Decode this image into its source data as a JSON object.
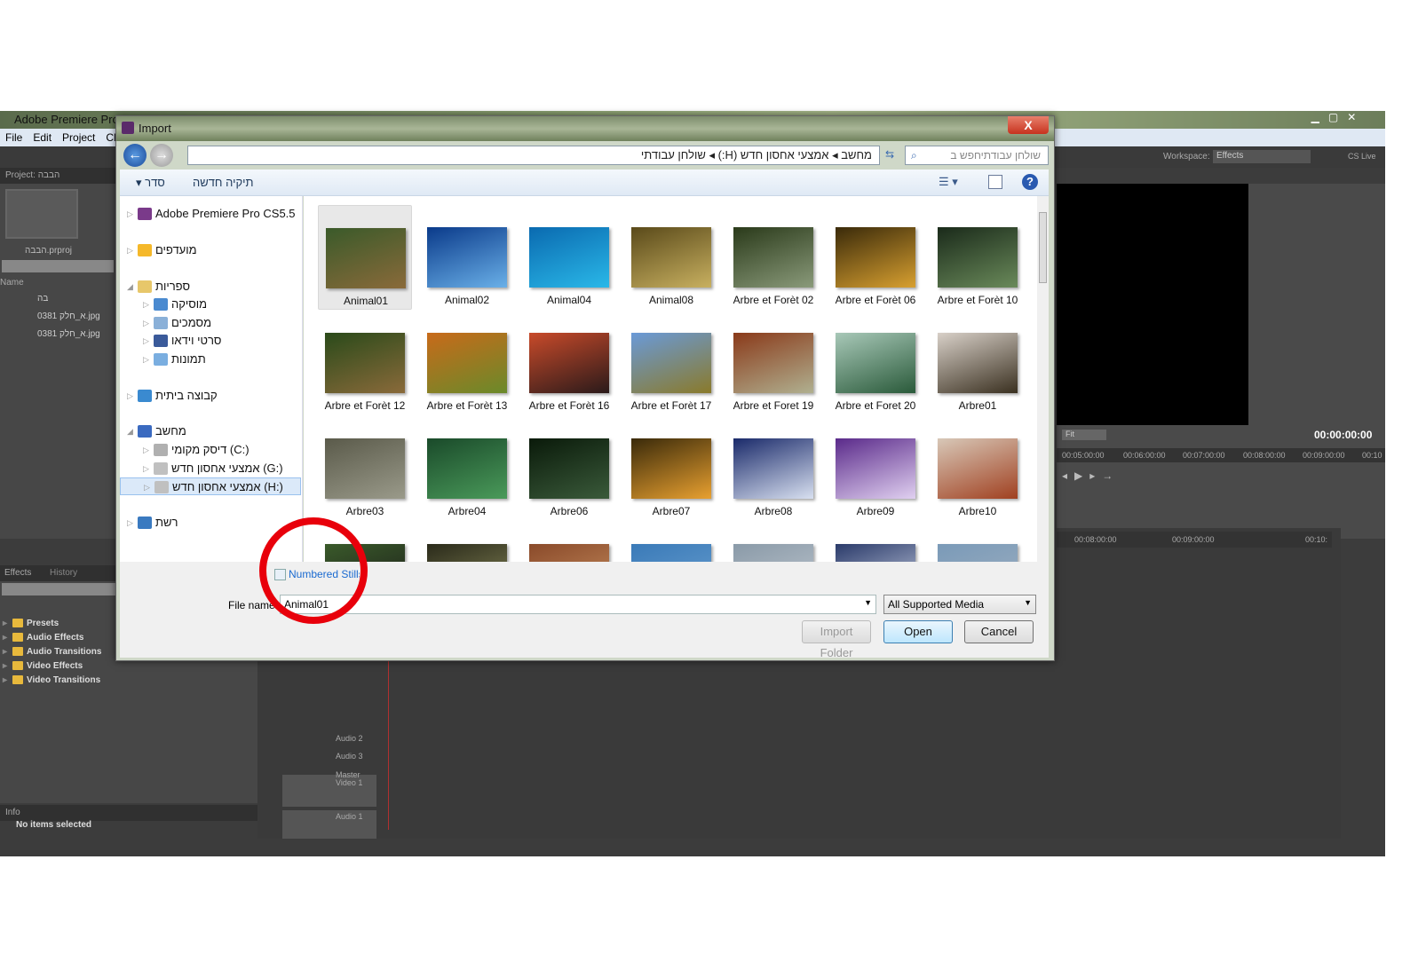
{
  "app": {
    "title": "Adobe Premiere Pro",
    "menu": [
      "File",
      "Edit",
      "Project",
      "Clip"
    ],
    "workspace_label": "Workspace:",
    "workspace_value": "Effects",
    "cslive": "CS Live",
    "project_tab": "Project: הבבה",
    "project_file": "הבבה.prproj",
    "name_col": "Name",
    "project_items": [
      "בה",
      "0381 א_חלק.jpg",
      "0381 א_חלק.jpg"
    ],
    "effects_tabs": [
      "Effects",
      "History"
    ],
    "effects_tree": [
      "Presets",
      "Audio Effects",
      "Audio Transitions",
      "Video Effects",
      "Video Transitions"
    ],
    "info_tab": "Info",
    "info_text": "No items selected",
    "monitor": {
      "fit": "Fit",
      "timecode": "00:00:00:00",
      "ruler": [
        "00:05:00:00",
        "00:06:00:00",
        "00:07:00:00",
        "00:08:00:00",
        "00:09:00:00",
        "00:10"
      ]
    },
    "timeline_ruler": [
      "00:08:00:00",
      "00:09:00:00",
      "00:10:"
    ],
    "tracks": [
      "Video 1",
      "Audio 1",
      "Audio 2",
      "Audio 3",
      "Master"
    ]
  },
  "dialog": {
    "title": "Import",
    "close": "X",
    "path": [
      "מחשב",
      "אמצעי אחסון חדש (H:)",
      "שולחן עבודתי"
    ],
    "search_placeholder": "שולחן עבודתיחפש ב",
    "toolbar": {
      "organize": "סדר ▾",
      "new_folder": "תיקיה חדשה"
    },
    "nav": [
      {
        "label": "Adobe Premiere Pro CS5.5",
        "level": 0,
        "icon": "premiere-icon",
        "color": "#7a3a8a"
      },
      {
        "label": "מועדפים",
        "level": 0,
        "icon": "star-icon",
        "color": "#f5b82a"
      },
      {
        "label": "ספריות",
        "level": 0,
        "icon": "libraries-icon",
        "color": "#e7c76a",
        "expanded": true
      },
      {
        "label": "מוסיקה",
        "level": 1,
        "icon": "music-icon",
        "color": "#4a8ad0"
      },
      {
        "label": "מסמכים",
        "level": 1,
        "icon": "documents-icon",
        "color": "#8ab0d8"
      },
      {
        "label": "סרטי וידאו",
        "level": 1,
        "icon": "videos-icon",
        "color": "#3a5a9a"
      },
      {
        "label": "תמונות",
        "level": 1,
        "icon": "pictures-icon",
        "color": "#7aaee0"
      },
      {
        "label": "קבוצה ביתית",
        "level": 0,
        "icon": "homegroup-icon",
        "color": "#3a8ad0"
      },
      {
        "label": "מחשב",
        "level": 0,
        "icon": "computer-icon",
        "color": "#3a6ac0",
        "expanded": true
      },
      {
        "label": "דיסק מקומי (C:)",
        "level": 1,
        "icon": "disk-icon",
        "color": "#b0b0b0"
      },
      {
        "label": "אמצעי אחסון חדש (G:)",
        "level": 1,
        "icon": "drive-icon",
        "color": "#c0c0c0"
      },
      {
        "label": "אמצעי אחסון חדש (H:)",
        "level": 1,
        "icon": "drive-icon",
        "color": "#c0c0c0",
        "selected": true
      },
      {
        "label": "רשת",
        "level": 0,
        "icon": "network-icon",
        "color": "#3a7ac0"
      }
    ],
    "files": [
      {
        "name": "Animal01",
        "c": [
          "#3a5a2a",
          "#8a6a3a"
        ],
        "selected": true
      },
      {
        "name": "Animal02",
        "c": [
          "#0a3a8a",
          "#6ab0e8"
        ]
      },
      {
        "name": "Animal04",
        "c": [
          "#0a6ab0",
          "#2ab8e8"
        ]
      },
      {
        "name": "Animal08",
        "c": [
          "#5a4a1a",
          "#c8b060"
        ]
      },
      {
        "name": "Arbre et Forèt 02",
        "c": [
          "#2a3a1a",
          "#8a9a7a"
        ]
      },
      {
        "name": "Arbre et Forèt 06",
        "c": [
          "#3a2a0a",
          "#d8a030"
        ]
      },
      {
        "name": "Arbre et Forèt 10",
        "c": [
          "#1a2a1a",
          "#6a8a5a"
        ]
      },
      {
        "name": "Arbre et Forèt 12",
        "c": [
          "#2a4a1a",
          "#8a6a3a"
        ]
      },
      {
        "name": "Arbre et Forèt 13",
        "c": [
          "#c86a1a",
          "#6a8a2a"
        ]
      },
      {
        "name": "Arbre et Forèt 16",
        "c": [
          "#c84a2a",
          "#2a1a1a"
        ]
      },
      {
        "name": "Arbre et Forèt 17",
        "c": [
          "#6a9ad8",
          "#8a7a2a"
        ]
      },
      {
        "name": "Arbre et Foret 19",
        "c": [
          "#8a3a1a",
          "#b0b090"
        ]
      },
      {
        "name": "Arbre et Foret 20",
        "c": [
          "#a8c8b8",
          "#2a5a3a"
        ]
      },
      {
        "name": "Arbre01",
        "c": [
          "#d8d0c8",
          "#3a3020"
        ]
      },
      {
        "name": "Arbre03",
        "c": [
          "#5a5a4a",
          "#9a9a8a"
        ]
      },
      {
        "name": "Arbre04",
        "c": [
          "#1a4a2a",
          "#4a9a5a"
        ]
      },
      {
        "name": "Arbre06",
        "c": [
          "#0a1a0a",
          "#3a5a3a"
        ]
      },
      {
        "name": "Arbre07",
        "c": [
          "#3a2a0a",
          "#e8a030"
        ]
      },
      {
        "name": "Arbre08",
        "c": [
          "#1a2a6a",
          "#d8e0f0"
        ]
      },
      {
        "name": "Arbre09",
        "c": [
          "#5a2a8a",
          "#e0d0f0"
        ]
      },
      {
        "name": "Arbre10",
        "c": [
          "#d8c8b8",
          "#a04020"
        ]
      },
      {
        "name": "",
        "c": [
          "#3a5a2a",
          "#1a1a1a"
        ]
      },
      {
        "name": "",
        "c": [
          "#2a2a1a",
          "#8a8a5a"
        ]
      },
      {
        "name": "",
        "c": [
          "#8a4a2a",
          "#c89060"
        ]
      },
      {
        "name": "",
        "c": [
          "#3a7ab8",
          "#6aa0d0"
        ]
      },
      {
        "name": "",
        "c": [
          "#8a9aa8",
          "#c0c8d0"
        ]
      },
      {
        "name": "",
        "c": [
          "#2a3a6a",
          "#d0d8e8"
        ]
      },
      {
        "name": "",
        "c": [
          "#7a9ab8",
          "#a0b0c0"
        ]
      }
    ],
    "numbered_stills": "Numbered Stills",
    "file_name_label": "File name:",
    "file_name_value": "Animal01",
    "file_type": "All Supported Media",
    "import_folder": "Import Folder",
    "open": "Open",
    "cancel": "Cancel"
  }
}
